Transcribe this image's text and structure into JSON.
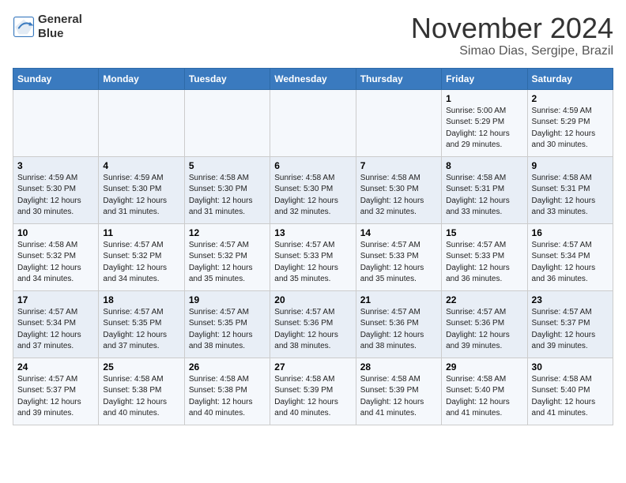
{
  "logo": {
    "line1": "General",
    "line2": "Blue"
  },
  "title": "November 2024",
  "location": "Simao Dias, Sergipe, Brazil",
  "days_header": [
    "Sunday",
    "Monday",
    "Tuesday",
    "Wednesday",
    "Thursday",
    "Friday",
    "Saturday"
  ],
  "weeks": [
    [
      {
        "num": "",
        "info": ""
      },
      {
        "num": "",
        "info": ""
      },
      {
        "num": "",
        "info": ""
      },
      {
        "num": "",
        "info": ""
      },
      {
        "num": "",
        "info": ""
      },
      {
        "num": "1",
        "info": "Sunrise: 5:00 AM\nSunset: 5:29 PM\nDaylight: 12 hours and 29 minutes."
      },
      {
        "num": "2",
        "info": "Sunrise: 4:59 AM\nSunset: 5:29 PM\nDaylight: 12 hours and 30 minutes."
      }
    ],
    [
      {
        "num": "3",
        "info": "Sunrise: 4:59 AM\nSunset: 5:30 PM\nDaylight: 12 hours and 30 minutes."
      },
      {
        "num": "4",
        "info": "Sunrise: 4:59 AM\nSunset: 5:30 PM\nDaylight: 12 hours and 31 minutes."
      },
      {
        "num": "5",
        "info": "Sunrise: 4:58 AM\nSunset: 5:30 PM\nDaylight: 12 hours and 31 minutes."
      },
      {
        "num": "6",
        "info": "Sunrise: 4:58 AM\nSunset: 5:30 PM\nDaylight: 12 hours and 32 minutes."
      },
      {
        "num": "7",
        "info": "Sunrise: 4:58 AM\nSunset: 5:30 PM\nDaylight: 12 hours and 32 minutes."
      },
      {
        "num": "8",
        "info": "Sunrise: 4:58 AM\nSunset: 5:31 PM\nDaylight: 12 hours and 33 minutes."
      },
      {
        "num": "9",
        "info": "Sunrise: 4:58 AM\nSunset: 5:31 PM\nDaylight: 12 hours and 33 minutes."
      }
    ],
    [
      {
        "num": "10",
        "info": "Sunrise: 4:58 AM\nSunset: 5:32 PM\nDaylight: 12 hours and 34 minutes."
      },
      {
        "num": "11",
        "info": "Sunrise: 4:57 AM\nSunset: 5:32 PM\nDaylight: 12 hours and 34 minutes."
      },
      {
        "num": "12",
        "info": "Sunrise: 4:57 AM\nSunset: 5:32 PM\nDaylight: 12 hours and 35 minutes."
      },
      {
        "num": "13",
        "info": "Sunrise: 4:57 AM\nSunset: 5:33 PM\nDaylight: 12 hours and 35 minutes."
      },
      {
        "num": "14",
        "info": "Sunrise: 4:57 AM\nSunset: 5:33 PM\nDaylight: 12 hours and 35 minutes."
      },
      {
        "num": "15",
        "info": "Sunrise: 4:57 AM\nSunset: 5:33 PM\nDaylight: 12 hours and 36 minutes."
      },
      {
        "num": "16",
        "info": "Sunrise: 4:57 AM\nSunset: 5:34 PM\nDaylight: 12 hours and 36 minutes."
      }
    ],
    [
      {
        "num": "17",
        "info": "Sunrise: 4:57 AM\nSunset: 5:34 PM\nDaylight: 12 hours and 37 minutes."
      },
      {
        "num": "18",
        "info": "Sunrise: 4:57 AM\nSunset: 5:35 PM\nDaylight: 12 hours and 37 minutes."
      },
      {
        "num": "19",
        "info": "Sunrise: 4:57 AM\nSunset: 5:35 PM\nDaylight: 12 hours and 38 minutes."
      },
      {
        "num": "20",
        "info": "Sunrise: 4:57 AM\nSunset: 5:36 PM\nDaylight: 12 hours and 38 minutes."
      },
      {
        "num": "21",
        "info": "Sunrise: 4:57 AM\nSunset: 5:36 PM\nDaylight: 12 hours and 38 minutes."
      },
      {
        "num": "22",
        "info": "Sunrise: 4:57 AM\nSunset: 5:36 PM\nDaylight: 12 hours and 39 minutes."
      },
      {
        "num": "23",
        "info": "Sunrise: 4:57 AM\nSunset: 5:37 PM\nDaylight: 12 hours and 39 minutes."
      }
    ],
    [
      {
        "num": "24",
        "info": "Sunrise: 4:57 AM\nSunset: 5:37 PM\nDaylight: 12 hours and 39 minutes."
      },
      {
        "num": "25",
        "info": "Sunrise: 4:58 AM\nSunset: 5:38 PM\nDaylight: 12 hours and 40 minutes."
      },
      {
        "num": "26",
        "info": "Sunrise: 4:58 AM\nSunset: 5:38 PM\nDaylight: 12 hours and 40 minutes."
      },
      {
        "num": "27",
        "info": "Sunrise: 4:58 AM\nSunset: 5:39 PM\nDaylight: 12 hours and 40 minutes."
      },
      {
        "num": "28",
        "info": "Sunrise: 4:58 AM\nSunset: 5:39 PM\nDaylight: 12 hours and 41 minutes."
      },
      {
        "num": "29",
        "info": "Sunrise: 4:58 AM\nSunset: 5:40 PM\nDaylight: 12 hours and 41 minutes."
      },
      {
        "num": "30",
        "info": "Sunrise: 4:58 AM\nSunset: 5:40 PM\nDaylight: 12 hours and 41 minutes."
      }
    ]
  ]
}
